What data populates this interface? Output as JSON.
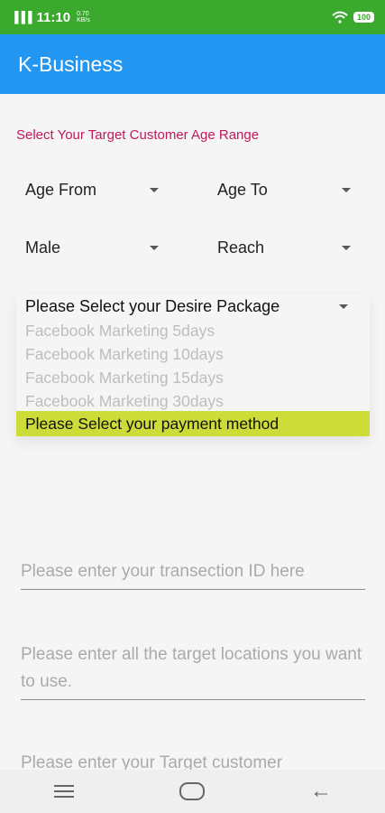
{
  "status_bar": {
    "signal": "▐▐▐",
    "time": "11:10",
    "speed_value": "0.70",
    "speed_unit": "KB/s",
    "battery": "100"
  },
  "app_bar": {
    "title": "K-Business"
  },
  "form": {
    "age_range_label": "Select Your Target Customer Age Range",
    "age_from": "Age From",
    "age_to": "Age To",
    "gender": "Male",
    "reach": "Reach",
    "package": "Please Select your Desire Package",
    "package_options": [
      "Facebook Marketing 5days",
      "Facebook Marketing 10days",
      "Facebook Marketing 15days",
      "Facebook Marketing 30days"
    ],
    "payment_method": "Please Select your payment method",
    "transaction_placeholder": "Please enter your transection ID here",
    "locations_placeholder": "Please enter all the target locations you want to use.",
    "target_customer_placeholder": "Please enter your Target customer"
  },
  "colors": {
    "status_bar": "#3aa92d",
    "app_bar": "#2196f3",
    "label_accent": "#c2185b",
    "highlight": "#cddc39"
  }
}
